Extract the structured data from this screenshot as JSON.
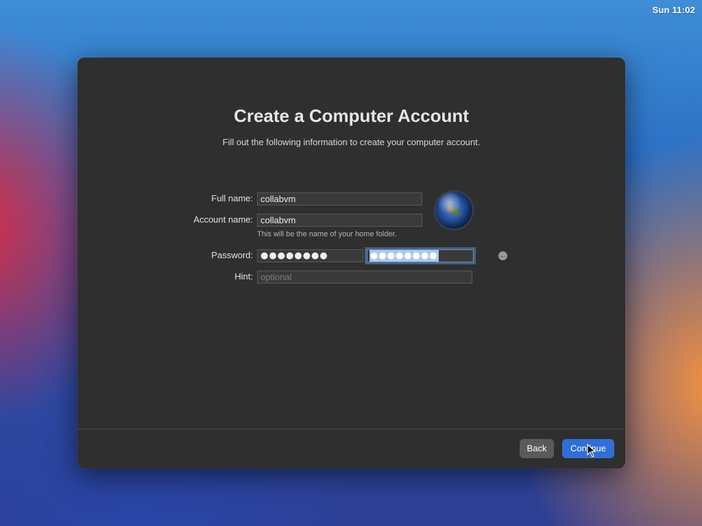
{
  "menubar": {
    "clock": "Sun 11:02"
  },
  "dialog": {
    "title": "Create a Computer Account",
    "subtitle": "Fill out the following information to create your computer account.",
    "fields": {
      "full_name": {
        "label": "Full name:",
        "value": "collabvm"
      },
      "account_name": {
        "label": "Account name:",
        "value": "collabvm",
        "helper": "This will be the name of your home folder."
      },
      "password": {
        "label": "Password:",
        "value_masked": "●●●●●●●●",
        "verify_masked": "●●●●●●●●"
      },
      "hint": {
        "label": "Hint:",
        "placeholder": "optional",
        "value": ""
      }
    },
    "avatar_icon": "globe-icon",
    "reveal_icon": "arrow-left-circle-icon",
    "buttons": {
      "back": "Back",
      "continue": "Continue"
    }
  }
}
